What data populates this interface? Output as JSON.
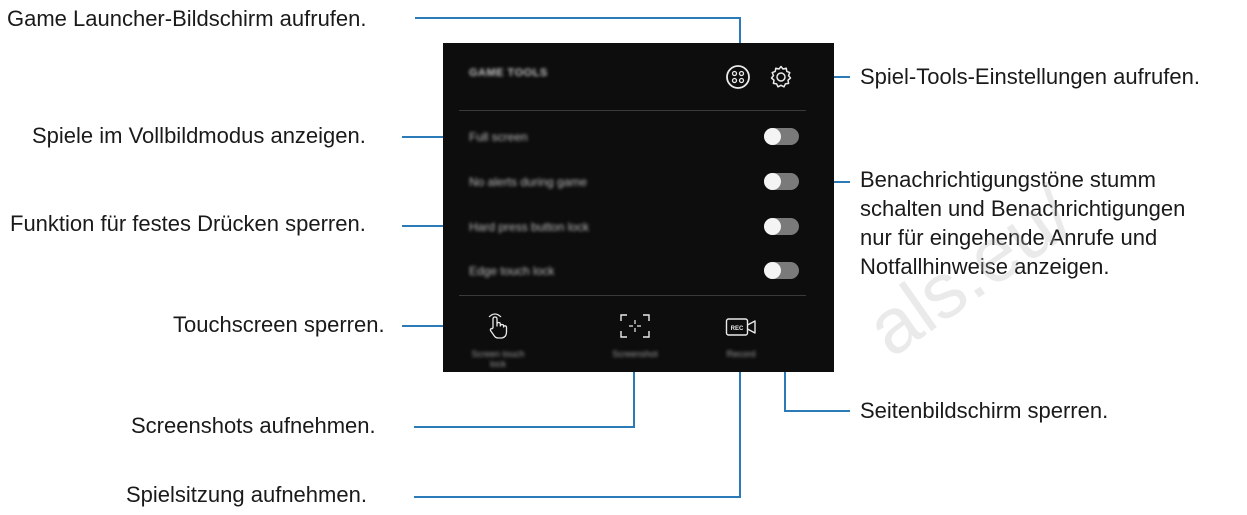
{
  "panel": {
    "title": "GAME TOOLS",
    "toggles": [
      {
        "label": "Full screen",
        "state": "off"
      },
      {
        "label": "No alerts during game",
        "state": "off"
      },
      {
        "label": "Hard press button lock",
        "state": "off"
      },
      {
        "label": "Edge touch lock",
        "state": "off"
      }
    ],
    "bottom_buttons": [
      {
        "label": "Screen touch lock",
        "icon": "touch-lock-icon"
      },
      {
        "label": "Screenshot",
        "icon": "screenshot-icon"
      },
      {
        "label": "Record",
        "icon": "record-icon"
      }
    ],
    "top_icons": [
      "game-launcher-icon",
      "gear-icon"
    ],
    "colors": {
      "background": "#0d0d0d",
      "toggle_track": "#7a7a7a",
      "toggle_knob": "#f4f4f4",
      "leader": "#2a7bb8"
    }
  },
  "callouts": {
    "game_launcher": "Game Launcher-Bildschirm aufrufen.",
    "settings": "Spiel-Tools-Einstellungen aufrufen.",
    "full_screen": "Spiele im Vollbildmodus anzeigen.",
    "no_alerts": "Benachrichtigungstöne stumm schalten und Benachrichtigungen nur für eingehende Anrufe und Notfallhinweise anzeigen.",
    "no_alerts_lines": [
      "Benachrichtigungstöne stumm",
      "schalten und Benachrichtigungen",
      "nur für eingehende Anrufe und",
      "Notfallhinweise anzeigen."
    ],
    "hard_press": "Funktion für festes Drücken sperren.",
    "touchscreen": "Touchscreen sperren.",
    "edge_lock": "Seitenbildschirm sperren.",
    "screenshots": "Screenshots aufnehmen.",
    "record": "Spielsitzung aufnehmen."
  },
  "watermark": "als.eu/"
}
